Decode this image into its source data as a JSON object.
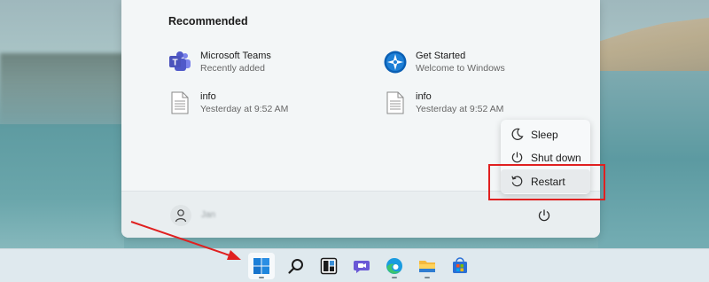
{
  "start_menu": {
    "recommended_title": "Recommended",
    "recommended": [
      {
        "name": "Microsoft Teams",
        "subtitle": "Recently added",
        "icon": "teams-icon"
      },
      {
        "name": "Get Started",
        "subtitle": "Welcome to Windows",
        "icon": "get-started-icon"
      },
      {
        "name": "info",
        "subtitle": "Yesterday at 9:52 AM",
        "icon": "document-icon"
      },
      {
        "name": "info",
        "subtitle": "Yesterday at 9:52 AM",
        "icon": "document-icon"
      }
    ],
    "user_name": "Jan"
  },
  "power_menu": {
    "items": [
      {
        "label": "Sleep",
        "icon": "sleep-icon"
      },
      {
        "label": "Shut down",
        "icon": "power-icon"
      },
      {
        "label": "Restart",
        "icon": "restart-icon"
      }
    ],
    "selected": "Restart"
  },
  "taskbar": {
    "items": [
      "start-icon",
      "search-icon",
      "widgets-icon",
      "chat-icon",
      "edge-icon",
      "file-explorer-icon",
      "store-icon"
    ]
  },
  "colors": {
    "highlight": "#e02020",
    "accent": "#0067c0"
  }
}
